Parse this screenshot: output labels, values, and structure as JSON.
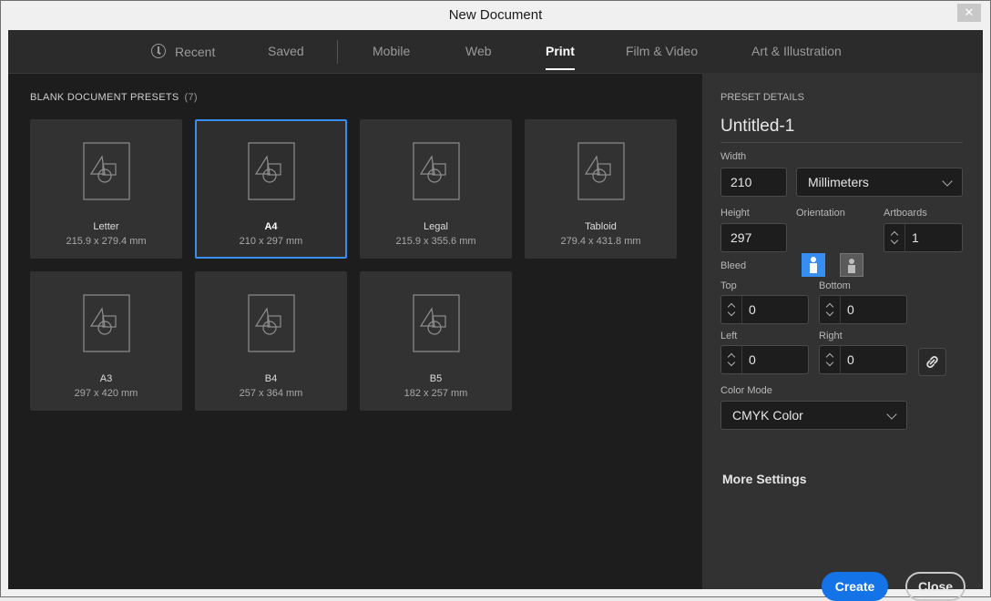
{
  "window": {
    "title": "New Document",
    "close_glyph": "✕"
  },
  "tabs": [
    {
      "label": "Recent",
      "icon": "clock-icon"
    },
    {
      "label": "Saved"
    },
    {
      "label": "Mobile"
    },
    {
      "label": "Web"
    },
    {
      "label": "Print",
      "active": true
    },
    {
      "label": "Film & Video"
    },
    {
      "label": "Art & Illustration"
    }
  ],
  "presets": {
    "heading": "BLANK DOCUMENT PRESETS",
    "count": "(7)",
    "items": [
      {
        "name": "Letter",
        "dims": "215.9 x 279.4 mm"
      },
      {
        "name": "A4",
        "dims": "210 x 297 mm",
        "selected": true
      },
      {
        "name": "Legal",
        "dims": "215.9 x 355.6 mm"
      },
      {
        "name": "Tabloid",
        "dims": "279.4 x 431.8 mm"
      },
      {
        "name": "A3",
        "dims": "297 x 420 mm"
      },
      {
        "name": "B4",
        "dims": "257 x 364 mm"
      },
      {
        "name": "B5",
        "dims": "182 x 257 mm"
      }
    ]
  },
  "details": {
    "heading": "PRESET DETAILS",
    "doc_name": "Untitled-1",
    "width_label": "Width",
    "width_value": "210",
    "units": "Millimeters",
    "height_label": "Height",
    "height_value": "297",
    "orientation_label": "Orientation",
    "orientation_selected": "portrait",
    "artboards_label": "Artboards",
    "artboards_value": "1",
    "bleed_label": "Bleed",
    "bleed": {
      "top_label": "Top",
      "top_value": "0",
      "bottom_label": "Bottom",
      "bottom_value": "0",
      "left_label": "Left",
      "left_value": "0",
      "right_label": "Right",
      "right_value": "0"
    },
    "color_mode_label": "Color Mode",
    "color_mode_value": "CMYK Color",
    "more_settings": "More Settings"
  },
  "buttons": {
    "create": "Create",
    "close": "Close"
  },
  "colors": {
    "accent": "#1473e6",
    "selection": "#378ef0",
    "background": "#1d1d1d",
    "panel": "#323232"
  }
}
